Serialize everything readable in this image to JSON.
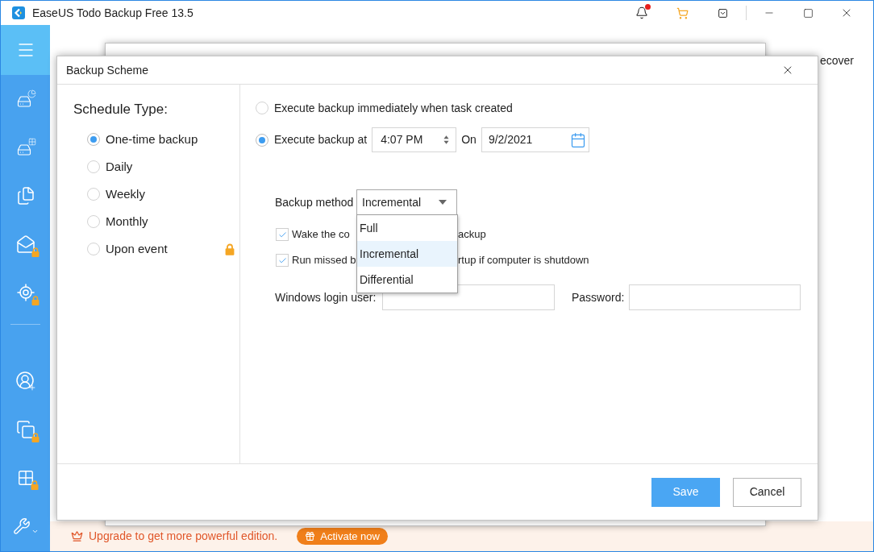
{
  "window": {
    "title": "EaseUS Todo Backup Free 13.5",
    "notification_dot": true
  },
  "sidebar": {
    "top_items": [
      {
        "locked": false
      },
      {
        "locked": false
      },
      {
        "locked": false
      },
      {
        "locked": true
      },
      {
        "locked": true
      }
    ],
    "bottom_items": [
      {
        "locked": false
      },
      {
        "locked": true
      },
      {
        "locked": true
      },
      {
        "locked": false
      }
    ]
  },
  "main": {
    "partial_label": "ecover"
  },
  "dialog": {
    "title": "Backup Scheme",
    "schedule_type": {
      "heading": "Schedule Type:",
      "options": [
        {
          "label": "One-time backup",
          "selected": true,
          "locked": false
        },
        {
          "label": "Daily",
          "selected": false,
          "locked": false
        },
        {
          "label": "Weekly",
          "selected": false,
          "locked": false
        },
        {
          "label": "Monthly",
          "selected": false,
          "locked": false
        },
        {
          "label": "Upon event",
          "selected": false,
          "locked": true
        }
      ]
    },
    "execute_options": [
      {
        "kind": "immediate",
        "label": "Execute backup immediately when task created",
        "selected": false
      },
      {
        "kind": "scheduled",
        "label": "Execute backup at",
        "selected": true,
        "time": "4:07 PM",
        "on_label": "On",
        "date": "9/2/2021"
      }
    ],
    "backup_method": {
      "label": "Backup method",
      "value": "Incremental",
      "expanded": true,
      "options": [
        {
          "label": "Full",
          "selected": false
        },
        {
          "label": "Incremental",
          "selected": true
        },
        {
          "label": "Differential",
          "selected": false
        }
      ]
    },
    "checkboxes": [
      {
        "checked": true,
        "label_parts": [
          "Wake the co",
          "ackup"
        ]
      },
      {
        "checked": true,
        "label_parts": [
          "Run missed b",
          "rtup if computer is shutdown"
        ]
      }
    ],
    "login": {
      "user_label": "Windows login user:",
      "password_label": "Password:"
    },
    "buttons": [
      {
        "kind": "primary",
        "label": "Save"
      },
      {
        "kind": "secondary",
        "label": "Cancel"
      }
    ]
  },
  "upgrade_bar": {
    "text": "Upgrade to get more powerful edition.",
    "button": "Activate now"
  }
}
